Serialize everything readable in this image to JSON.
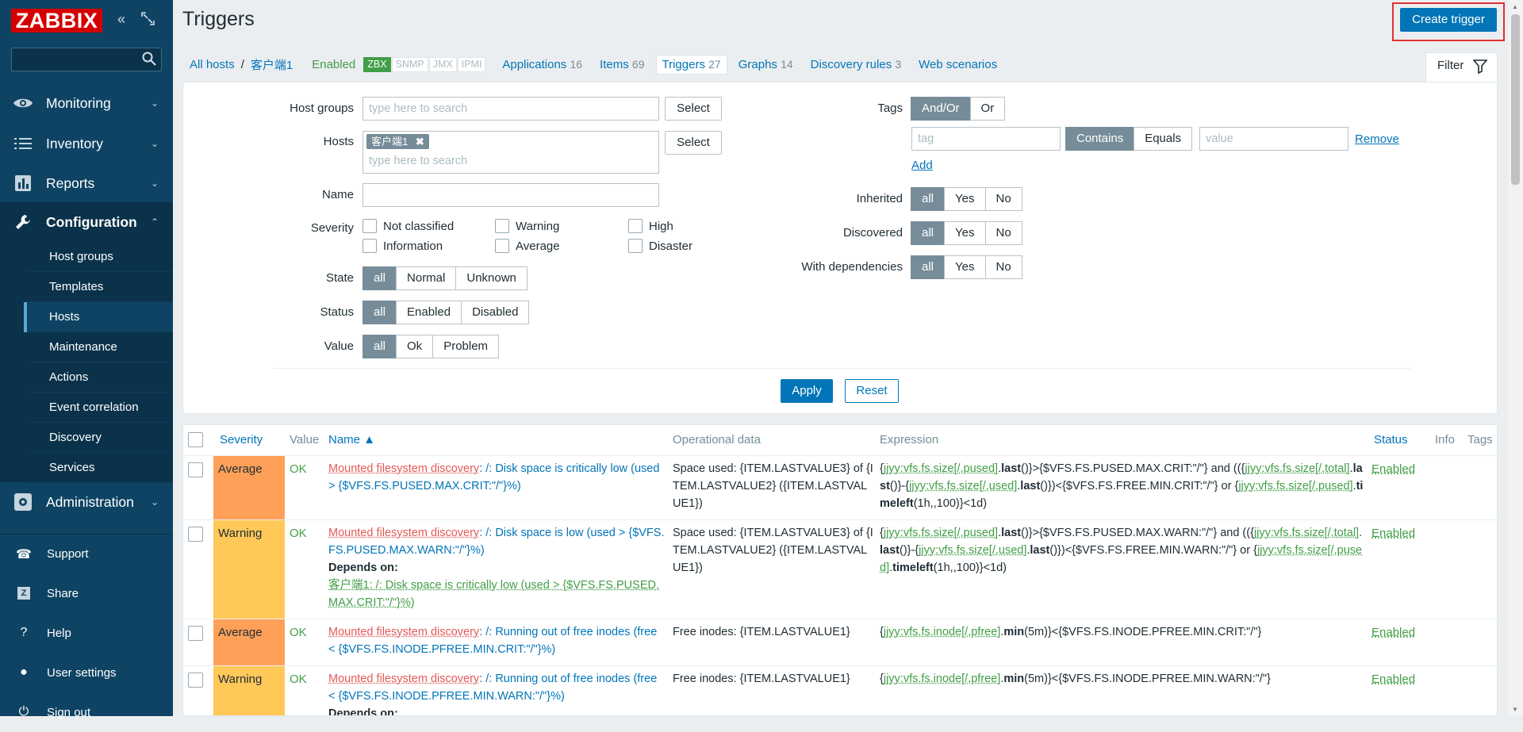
{
  "app": {
    "logo_text": "ZABBIX"
  },
  "sidebar": {
    "menu": [
      {
        "label": "Monitoring",
        "icon": "eye-icon"
      },
      {
        "label": "Inventory",
        "icon": "list-icon"
      },
      {
        "label": "Reports",
        "icon": "bar-chart-icon"
      },
      {
        "label": "Configuration",
        "icon": "wrench-icon"
      }
    ],
    "configuration_items": [
      "Host groups",
      "Templates",
      "Hosts",
      "Maintenance",
      "Actions",
      "Event correlation",
      "Discovery",
      "Services"
    ],
    "active_item": "Hosts",
    "administration": "Administration",
    "bottom": [
      "Support",
      "Share",
      "Help",
      "User settings",
      "Sign out"
    ]
  },
  "page": {
    "title": "Triggers",
    "create_button": "Create trigger"
  },
  "breadcrumb": {
    "all_hosts": "All hosts",
    "sep": "/",
    "host": "客户端1",
    "enabled": "Enabled",
    "availability": [
      "ZBX",
      "SNMP",
      "JMX",
      "IPMI"
    ],
    "tabs": [
      {
        "label": "Applications",
        "count": "16"
      },
      {
        "label": "Items",
        "count": "69"
      },
      {
        "label": "Triggers",
        "count": "27"
      },
      {
        "label": "Graphs",
        "count": "14"
      },
      {
        "label": "Discovery rules",
        "count": "3"
      },
      {
        "label": "Web scenarios",
        "count": ""
      }
    ]
  },
  "filter": {
    "tab_label": "Filter",
    "host_groups_label": "Host groups",
    "hosts_label": "Hosts",
    "search_placeholder": "type here to search",
    "select_label": "Select",
    "host_chip": "客户端1",
    "name_label": "Name",
    "severity_label": "Severity",
    "severities": [
      "Not classified",
      "Warning",
      "High",
      "Information",
      "Average",
      "Disaster"
    ],
    "state_label": "State",
    "state_opts": [
      "all",
      "Normal",
      "Unknown"
    ],
    "status_label": "Status",
    "status_opts": [
      "all",
      "Enabled",
      "Disabled"
    ],
    "value_label": "Value",
    "value_opts": [
      "all",
      "Ok",
      "Problem"
    ],
    "tags_label": "Tags",
    "tags_opts": [
      "And/Or",
      "Or"
    ],
    "tag_placeholder": "tag",
    "tag_ops": [
      "Contains",
      "Equals"
    ],
    "value_placeholder": "value",
    "remove": "Remove",
    "add": "Add",
    "inherited_label": "Inherited",
    "discovered_label": "Discovered",
    "deps_label": "With dependencies",
    "ayn": [
      "all",
      "Yes",
      "No"
    ],
    "apply": "Apply",
    "reset": "Reset"
  },
  "table": {
    "headers": [
      "Severity",
      "Value",
      "Name ▲",
      "Operational data",
      "Expression",
      "Status",
      "Info",
      "Tags"
    ],
    "rows": [
      {
        "severity": "Average",
        "value": "OK",
        "prefix": "Mounted filesystem discovery",
        "name": ": /: Disk space is critically low (used > {$VFS.FS.PUSED.MAX.CRIT:\"/\"}%)",
        "opdata": "Space used: {ITEM.LASTVALUE3} of {ITEM.LASTVALUE2} ({ITEM.LASTVALUE1})",
        "status": "Enabled"
      },
      {
        "severity": "Warning",
        "value": "OK",
        "prefix": "Mounted filesystem discovery",
        "name": ": /: Disk space is low (used > {$VFS.FS.PUSED.MAX.WARN:\"/\"}%)",
        "depends_label": "Depends on:",
        "depends": "客户端1: /: Disk space is critically low (used > {$VFS.FS.PUSED.MAX.CRIT:\"/\"}%)",
        "opdata": "Space used: {ITEM.LASTVALUE3} of {ITEM.LASTVALUE2} ({ITEM.LASTVALUE1})",
        "status": "Enabled"
      },
      {
        "severity": "Average",
        "value": "OK",
        "prefix": "Mounted filesystem discovery",
        "name": ": /: Running out of free inodes (free < {$VFS.FS.INODE.PFREE.MIN.CRIT:\"/\"}%)",
        "opdata": "Free inodes: {ITEM.LASTVALUE1}",
        "status": "Enabled"
      },
      {
        "severity": "Warning",
        "value": "OK",
        "prefix": "Mounted filesystem discovery",
        "name": ": /: Running out of free inodes (free < {$VFS.FS.INODE.PFREE.MIN.WARN:\"/\"}%)",
        "depends_label": "Depends on:",
        "opdata": "Free inodes: {ITEM.LASTVALUE1}",
        "status": "Enabled"
      }
    ],
    "expressions": {
      "r1": {
        "i1": "jjyy:vfs.fs.size[/,pused]",
        "f1": "last",
        "t1": "()}>{$VFS.FS.PUSED.MAX.CRIT:\"/\"} and (({",
        "i2": "jjyy:vfs.fs.size[/,total]",
        "f2": "last",
        "t2": "()}-{",
        "i3": "jjyy:vfs.fs.size[/,used]",
        "f3": "last",
        "t3": "()})<{$VFS.FS.FREE.MIN.CRIT:\"/\"} or {",
        "i4": "jjyy:vfs.fs.size[/,pused]",
        "f4": "timeleft",
        "t4": "(1h,,100)}<1d)"
      },
      "r2": {
        "i1": "jjyy:vfs.fs.size[/,pused]",
        "f1": "last",
        "t1": "()}>{$VFS.FS.PUSED.MAX.WARN:\"/\"} and (({",
        "i2": "jjyy:vfs.fs.size[/,total]",
        "f2": "last",
        "t2": "()}-{",
        "i3": "jjyy:vfs.fs.size[/,used]",
        "f3": "last",
        "t3": "()})<{$VFS.FS.FREE.MIN.WARN:\"/\"} or {",
        "i4": "jjyy:vfs.fs.size[/,pused]",
        "f4": "timeleft",
        "t4": "(1h,,100)}<1d)"
      },
      "r3": {
        "i1": "jjyy:vfs.fs.inode[/,pfree]",
        "f1": "min",
        "t1": "(5m)}<{$VFS.FS.INODE.PFREE.MIN.CRIT:\"/\"}"
      },
      "r4": {
        "i1": "jjyy:vfs.fs.inode[/,pfree]",
        "f1": "min",
        "t1": "(5m)}<{$VFS.FS.INODE.PFREE.MIN.WARN:\"/\"}"
      }
    }
  }
}
